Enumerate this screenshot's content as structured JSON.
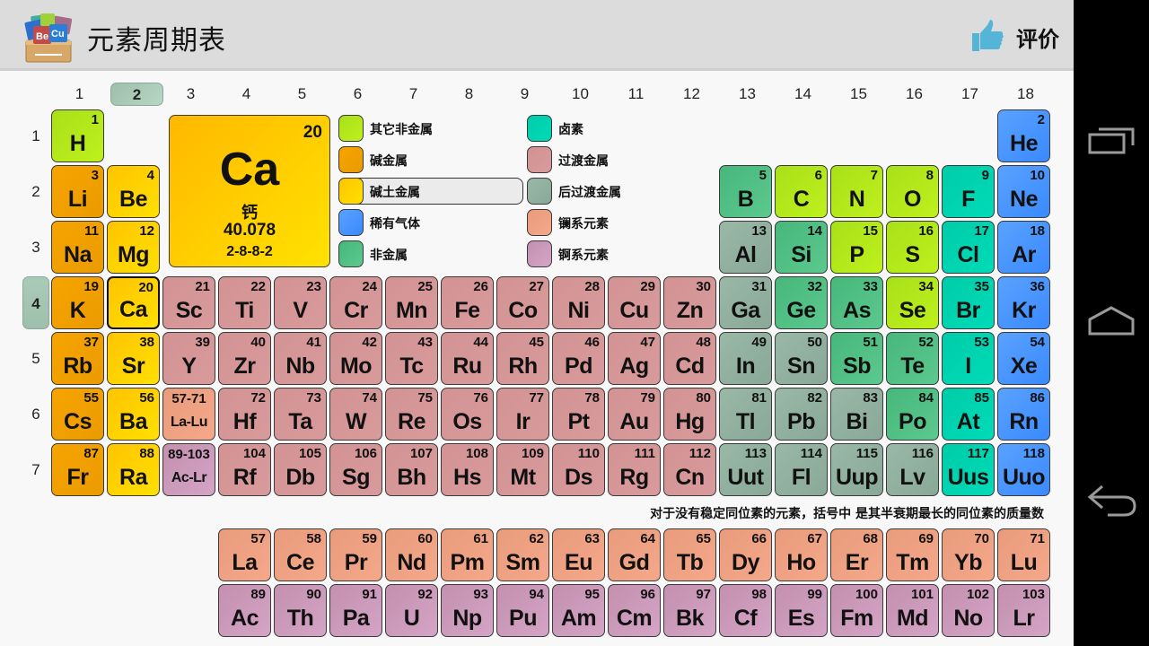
{
  "header": {
    "title": "元素周期表",
    "rate_label": "评价",
    "logo_icon": "periodic-table-box-icon",
    "rate_icon": "thumbs-up-icon"
  },
  "navbar": {
    "buttons": [
      {
        "name": "recent-apps",
        "icon": "recent-apps-icon"
      },
      {
        "name": "home",
        "icon": "home-icon"
      },
      {
        "name": "back",
        "icon": "back-icon"
      }
    ]
  },
  "groups": [
    "1",
    "2",
    "3",
    "4",
    "5",
    "6",
    "7",
    "8",
    "9",
    "10",
    "11",
    "12",
    "13",
    "14",
    "15",
    "16",
    "17",
    "18"
  ],
  "selected_group": "2",
  "periods": [
    "1",
    "2",
    "3",
    "4",
    "5",
    "6",
    "7"
  ],
  "selected_period": "4",
  "detail": {
    "number": "20",
    "symbol": "Ca",
    "name": "钙",
    "mass": "40.078",
    "config": "2-8-8-2",
    "category": "alkaline"
  },
  "legend": [
    {
      "key": "other-nonmetal",
      "label": "其它非金属",
      "color": "#b4e61b"
    },
    {
      "key": "alkali",
      "label": "碱金属",
      "color": "#f0a000"
    },
    {
      "key": "alkaline",
      "label": "碱土金属",
      "color": "#ffd000",
      "selected": true
    },
    {
      "key": "noble",
      "label": "稀有气体",
      "color": "#4a96ff"
    },
    {
      "key": "nonmetal",
      "label": "非金属",
      "color": "#50c084"
    },
    {
      "key": "halogen",
      "label": "卤素",
      "color": "#00d4b0"
    },
    {
      "key": "transition",
      "label": "过渡金属",
      "color": "#d69697"
    },
    {
      "key": "post-transition",
      "label": "后过渡金属",
      "color": "#92b09f"
    },
    {
      "key": "lanthanide",
      "label": "镧系元素",
      "color": "#efa283"
    },
    {
      "key": "actinide",
      "label": "锕系元素",
      "color": "#cc9aba"
    }
  ],
  "elements": [
    {
      "n": "1",
      "s": "H",
      "g": 1,
      "p": 1,
      "c": "other-nonmetal"
    },
    {
      "n": "2",
      "s": "He",
      "g": 18,
      "p": 1,
      "c": "noble"
    },
    {
      "n": "3",
      "s": "Li",
      "g": 1,
      "p": 2,
      "c": "alkali"
    },
    {
      "n": "4",
      "s": "Be",
      "g": 2,
      "p": 2,
      "c": "alkaline"
    },
    {
      "n": "5",
      "s": "B",
      "g": 13,
      "p": 2,
      "c": "nonmetal"
    },
    {
      "n": "6",
      "s": "C",
      "g": 14,
      "p": 2,
      "c": "other-nonmetal"
    },
    {
      "n": "7",
      "s": "N",
      "g": 15,
      "p": 2,
      "c": "other-nonmetal"
    },
    {
      "n": "8",
      "s": "O",
      "g": 16,
      "p": 2,
      "c": "other-nonmetal"
    },
    {
      "n": "9",
      "s": "F",
      "g": 17,
      "p": 2,
      "c": "halogen"
    },
    {
      "n": "10",
      "s": "Ne",
      "g": 18,
      "p": 2,
      "c": "noble"
    },
    {
      "n": "11",
      "s": "Na",
      "g": 1,
      "p": 3,
      "c": "alkali"
    },
    {
      "n": "12",
      "s": "Mg",
      "g": 2,
      "p": 3,
      "c": "alkaline"
    },
    {
      "n": "13",
      "s": "Al",
      "g": 13,
      "p": 3,
      "c": "post-transition"
    },
    {
      "n": "14",
      "s": "Si",
      "g": 14,
      "p": 3,
      "c": "nonmetal"
    },
    {
      "n": "15",
      "s": "P",
      "g": 15,
      "p": 3,
      "c": "other-nonmetal"
    },
    {
      "n": "16",
      "s": "S",
      "g": 16,
      "p": 3,
      "c": "other-nonmetal"
    },
    {
      "n": "17",
      "s": "Cl",
      "g": 17,
      "p": 3,
      "c": "halogen"
    },
    {
      "n": "18",
      "s": "Ar",
      "g": 18,
      "p": 3,
      "c": "noble"
    },
    {
      "n": "19",
      "s": "K",
      "g": 1,
      "p": 4,
      "c": "alkali"
    },
    {
      "n": "20",
      "s": "Ca",
      "g": 2,
      "p": 4,
      "c": "alkaline",
      "selected": true
    },
    {
      "n": "21",
      "s": "Sc",
      "g": 3,
      "p": 4,
      "c": "transition"
    },
    {
      "n": "22",
      "s": "Ti",
      "g": 4,
      "p": 4,
      "c": "transition"
    },
    {
      "n": "23",
      "s": "V",
      "g": 5,
      "p": 4,
      "c": "transition"
    },
    {
      "n": "24",
      "s": "Cr",
      "g": 6,
      "p": 4,
      "c": "transition"
    },
    {
      "n": "25",
      "s": "Mn",
      "g": 7,
      "p": 4,
      "c": "transition"
    },
    {
      "n": "26",
      "s": "Fe",
      "g": 8,
      "p": 4,
      "c": "transition"
    },
    {
      "n": "27",
      "s": "Co",
      "g": 9,
      "p": 4,
      "c": "transition"
    },
    {
      "n": "28",
      "s": "Ni",
      "g": 10,
      "p": 4,
      "c": "transition"
    },
    {
      "n": "29",
      "s": "Cu",
      "g": 11,
      "p": 4,
      "c": "transition"
    },
    {
      "n": "30",
      "s": "Zn",
      "g": 12,
      "p": 4,
      "c": "transition"
    },
    {
      "n": "31",
      "s": "Ga",
      "g": 13,
      "p": 4,
      "c": "post-transition"
    },
    {
      "n": "32",
      "s": "Ge",
      "g": 14,
      "p": 4,
      "c": "nonmetal"
    },
    {
      "n": "33",
      "s": "As",
      "g": 15,
      "p": 4,
      "c": "nonmetal"
    },
    {
      "n": "34",
      "s": "Se",
      "g": 16,
      "p": 4,
      "c": "other-nonmetal"
    },
    {
      "n": "35",
      "s": "Br",
      "g": 17,
      "p": 4,
      "c": "halogen"
    },
    {
      "n": "36",
      "s": "Kr",
      "g": 18,
      "p": 4,
      "c": "noble"
    },
    {
      "n": "37",
      "s": "Rb",
      "g": 1,
      "p": 5,
      "c": "alkali"
    },
    {
      "n": "38",
      "s": "Sr",
      "g": 2,
      "p": 5,
      "c": "alkaline"
    },
    {
      "n": "39",
      "s": "Y",
      "g": 3,
      "p": 5,
      "c": "transition"
    },
    {
      "n": "40",
      "s": "Zr",
      "g": 4,
      "p": 5,
      "c": "transition"
    },
    {
      "n": "41",
      "s": "Nb",
      "g": 5,
      "p": 5,
      "c": "transition"
    },
    {
      "n": "42",
      "s": "Mo",
      "g": 6,
      "p": 5,
      "c": "transition"
    },
    {
      "n": "43",
      "s": "Tc",
      "g": 7,
      "p": 5,
      "c": "transition"
    },
    {
      "n": "44",
      "s": "Ru",
      "g": 8,
      "p": 5,
      "c": "transition"
    },
    {
      "n": "45",
      "s": "Rh",
      "g": 9,
      "p": 5,
      "c": "transition"
    },
    {
      "n": "46",
      "s": "Pd",
      "g": 10,
      "p": 5,
      "c": "transition"
    },
    {
      "n": "47",
      "s": "Ag",
      "g": 11,
      "p": 5,
      "c": "transition"
    },
    {
      "n": "48",
      "s": "Cd",
      "g": 12,
      "p": 5,
      "c": "transition"
    },
    {
      "n": "49",
      "s": "In",
      "g": 13,
      "p": 5,
      "c": "post-transition"
    },
    {
      "n": "50",
      "s": "Sn",
      "g": 14,
      "p": 5,
      "c": "post-transition"
    },
    {
      "n": "51",
      "s": "Sb",
      "g": 15,
      "p": 5,
      "c": "nonmetal"
    },
    {
      "n": "52",
      "s": "Te",
      "g": 16,
      "p": 5,
      "c": "nonmetal"
    },
    {
      "n": "53",
      "s": "I",
      "g": 17,
      "p": 5,
      "c": "halogen"
    },
    {
      "n": "54",
      "s": "Xe",
      "g": 18,
      "p": 5,
      "c": "noble"
    },
    {
      "n": "55",
      "s": "Cs",
      "g": 1,
      "p": 6,
      "c": "alkali"
    },
    {
      "n": "56",
      "s": "Ba",
      "g": 2,
      "p": 6,
      "c": "alkaline"
    },
    {
      "n": "57-71",
      "s": "La-Lu",
      "g": 3,
      "p": 6,
      "c": "lanthanide",
      "range": true
    },
    {
      "n": "72",
      "s": "Hf",
      "g": 4,
      "p": 6,
      "c": "transition"
    },
    {
      "n": "73",
      "s": "Ta",
      "g": 5,
      "p": 6,
      "c": "transition"
    },
    {
      "n": "74",
      "s": "W",
      "g": 6,
      "p": 6,
      "c": "transition"
    },
    {
      "n": "75",
      "s": "Re",
      "g": 7,
      "p": 6,
      "c": "transition"
    },
    {
      "n": "76",
      "s": "Os",
      "g": 8,
      "p": 6,
      "c": "transition"
    },
    {
      "n": "77",
      "s": "Ir",
      "g": 9,
      "p": 6,
      "c": "transition"
    },
    {
      "n": "78",
      "s": "Pt",
      "g": 10,
      "p": 6,
      "c": "transition"
    },
    {
      "n": "79",
      "s": "Au",
      "g": 11,
      "p": 6,
      "c": "transition"
    },
    {
      "n": "80",
      "s": "Hg",
      "g": 12,
      "p": 6,
      "c": "transition"
    },
    {
      "n": "81",
      "s": "Tl",
      "g": 13,
      "p": 6,
      "c": "post-transition"
    },
    {
      "n": "82",
      "s": "Pb",
      "g": 14,
      "p": 6,
      "c": "post-transition"
    },
    {
      "n": "83",
      "s": "Bi",
      "g": 15,
      "p": 6,
      "c": "post-transition"
    },
    {
      "n": "84",
      "s": "Po",
      "g": 16,
      "p": 6,
      "c": "nonmetal"
    },
    {
      "n": "85",
      "s": "At",
      "g": 17,
      "p": 6,
      "c": "halogen"
    },
    {
      "n": "86",
      "s": "Rn",
      "g": 18,
      "p": 6,
      "c": "noble"
    },
    {
      "n": "87",
      "s": "Fr",
      "g": 1,
      "p": 7,
      "c": "alkali"
    },
    {
      "n": "88",
      "s": "Ra",
      "g": 2,
      "p": 7,
      "c": "alkaline"
    },
    {
      "n": "89-103",
      "s": "Ac-Lr",
      "g": 3,
      "p": 7,
      "c": "actinide",
      "range": true
    },
    {
      "n": "104",
      "s": "Rf",
      "g": 4,
      "p": 7,
      "c": "transition"
    },
    {
      "n": "105",
      "s": "Db",
      "g": 5,
      "p": 7,
      "c": "transition"
    },
    {
      "n": "106",
      "s": "Sg",
      "g": 6,
      "p": 7,
      "c": "transition"
    },
    {
      "n": "107",
      "s": "Bh",
      "g": 7,
      "p": 7,
      "c": "transition"
    },
    {
      "n": "108",
      "s": "Hs",
      "g": 8,
      "p": 7,
      "c": "transition"
    },
    {
      "n": "109",
      "s": "Mt",
      "g": 9,
      "p": 7,
      "c": "transition"
    },
    {
      "n": "110",
      "s": "Ds",
      "g": 10,
      "p": 7,
      "c": "transition"
    },
    {
      "n": "111",
      "s": "Rg",
      "g": 11,
      "p": 7,
      "c": "transition"
    },
    {
      "n": "112",
      "s": "Cn",
      "g": 12,
      "p": 7,
      "c": "transition"
    },
    {
      "n": "113",
      "s": "Uut",
      "g": 13,
      "p": 7,
      "c": "post-transition"
    },
    {
      "n": "114",
      "s": "Fl",
      "g": 14,
      "p": 7,
      "c": "post-transition"
    },
    {
      "n": "115",
      "s": "Uup",
      "g": 15,
      "p": 7,
      "c": "post-transition"
    },
    {
      "n": "116",
      "s": "Lv",
      "g": 16,
      "p": 7,
      "c": "post-transition"
    },
    {
      "n": "117",
      "s": "Uus",
      "g": 17,
      "p": 7,
      "c": "halogen"
    },
    {
      "n": "118",
      "s": "Uuo",
      "g": 18,
      "p": 7,
      "c": "noble"
    }
  ],
  "lanthanides": [
    {
      "n": "57",
      "s": "La"
    },
    {
      "n": "58",
      "s": "Ce"
    },
    {
      "n": "59",
      "s": "Pr"
    },
    {
      "n": "60",
      "s": "Nd"
    },
    {
      "n": "61",
      "s": "Pm"
    },
    {
      "n": "62",
      "s": "Sm"
    },
    {
      "n": "63",
      "s": "Eu"
    },
    {
      "n": "64",
      "s": "Gd"
    },
    {
      "n": "65",
      "s": "Tb"
    },
    {
      "n": "66",
      "s": "Dy"
    },
    {
      "n": "67",
      "s": "Ho"
    },
    {
      "n": "68",
      "s": "Er"
    },
    {
      "n": "69",
      "s": "Tm"
    },
    {
      "n": "70",
      "s": "Yb"
    },
    {
      "n": "71",
      "s": "Lu"
    }
  ],
  "actinides": [
    {
      "n": "89",
      "s": "Ac"
    },
    {
      "n": "90",
      "s": "Th"
    },
    {
      "n": "91",
      "s": "Pa"
    },
    {
      "n": "92",
      "s": "U"
    },
    {
      "n": "93",
      "s": "Np"
    },
    {
      "n": "94",
      "s": "Pu"
    },
    {
      "n": "95",
      "s": "Am"
    },
    {
      "n": "96",
      "s": "Cm"
    },
    {
      "n": "97",
      "s": "Bk"
    },
    {
      "n": "98",
      "s": "Cf"
    },
    {
      "n": "99",
      "s": "Es"
    },
    {
      "n": "100",
      "s": "Fm"
    },
    {
      "n": "101",
      "s": "Md"
    },
    {
      "n": "102",
      "s": "No"
    },
    {
      "n": "103",
      "s": "Lr"
    }
  ],
  "footnote": "对于没有稳定同位素的元素，括号中 是其半衰期最长的同位素的质量数"
}
